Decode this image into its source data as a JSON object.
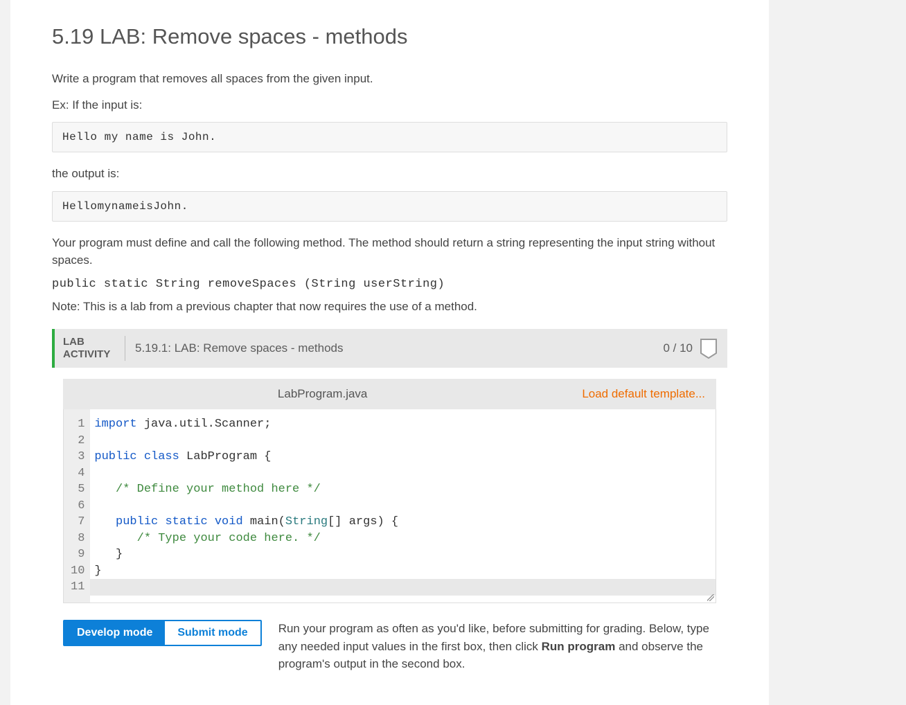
{
  "page": {
    "title": "5.19 LAB: Remove spaces - methods",
    "intro": "Write a program that removes all spaces from the given input.",
    "ex_label": "Ex: If the input is:",
    "ex_input": "Hello my name is John.",
    "out_label": "the output is:",
    "ex_output": "HellomynameisJohn.",
    "method_desc": "Your program must define and call the following method. The method should return a string representing the input string without spaces.",
    "method_sig": "public static String removeSpaces (String userString)",
    "note": "Note: This is a lab from a previous chapter that now requires the use of a method."
  },
  "lab": {
    "label": "LAB ACTIVITY",
    "title": "5.19.1: LAB: Remove spaces - methods",
    "score": "0 / 10"
  },
  "editor": {
    "filename": "LabProgram.java",
    "load_template": "Load default template...",
    "line_count": 11,
    "code_lines": [
      {
        "text": "import java.util.Scanner;",
        "tokens": [
          {
            "t": "import",
            "c": "kw"
          },
          {
            "t": " java.util.Scanner;",
            "c": ""
          }
        ]
      },
      {
        "text": "",
        "tokens": []
      },
      {
        "text": "public class LabProgram {",
        "tokens": [
          {
            "t": "public",
            "c": "kw"
          },
          {
            "t": " ",
            "c": ""
          },
          {
            "t": "class",
            "c": "kw"
          },
          {
            "t": " LabProgram {",
            "c": ""
          }
        ]
      },
      {
        "text": "",
        "tokens": []
      },
      {
        "text": "   /* Define your method here */",
        "tokens": [
          {
            "t": "   ",
            "c": ""
          },
          {
            "t": "/* Define your method here */",
            "c": "cm"
          }
        ]
      },
      {
        "text": "",
        "tokens": []
      },
      {
        "text": "   public static void main(String[] args) {",
        "tokens": [
          {
            "t": "   ",
            "c": ""
          },
          {
            "t": "public",
            "c": "kw"
          },
          {
            "t": " ",
            "c": ""
          },
          {
            "t": "static",
            "c": "kw"
          },
          {
            "t": " ",
            "c": ""
          },
          {
            "t": "void",
            "c": "kw"
          },
          {
            "t": " main(",
            "c": ""
          },
          {
            "t": "String",
            "c": "cls"
          },
          {
            "t": "[] args) {",
            "c": ""
          }
        ]
      },
      {
        "text": "      /* Type your code here. */",
        "tokens": [
          {
            "t": "      ",
            "c": ""
          },
          {
            "t": "/* Type your code here. */",
            "c": "cm"
          }
        ]
      },
      {
        "text": "   }",
        "tokens": [
          {
            "t": "   }",
            "c": ""
          }
        ]
      },
      {
        "text": "}",
        "tokens": [
          {
            "t": "}",
            "c": ""
          }
        ]
      },
      {
        "text": "",
        "tokens": []
      }
    ]
  },
  "modes": {
    "develop": "Develop mode",
    "submit": "Submit mode",
    "help_pre": "Run your program as often as you'd like, before submitting for grading. Below, type any needed input values in the first box, then click ",
    "help_bold": "Run program",
    "help_post": " and observe the program's output in the second box."
  }
}
